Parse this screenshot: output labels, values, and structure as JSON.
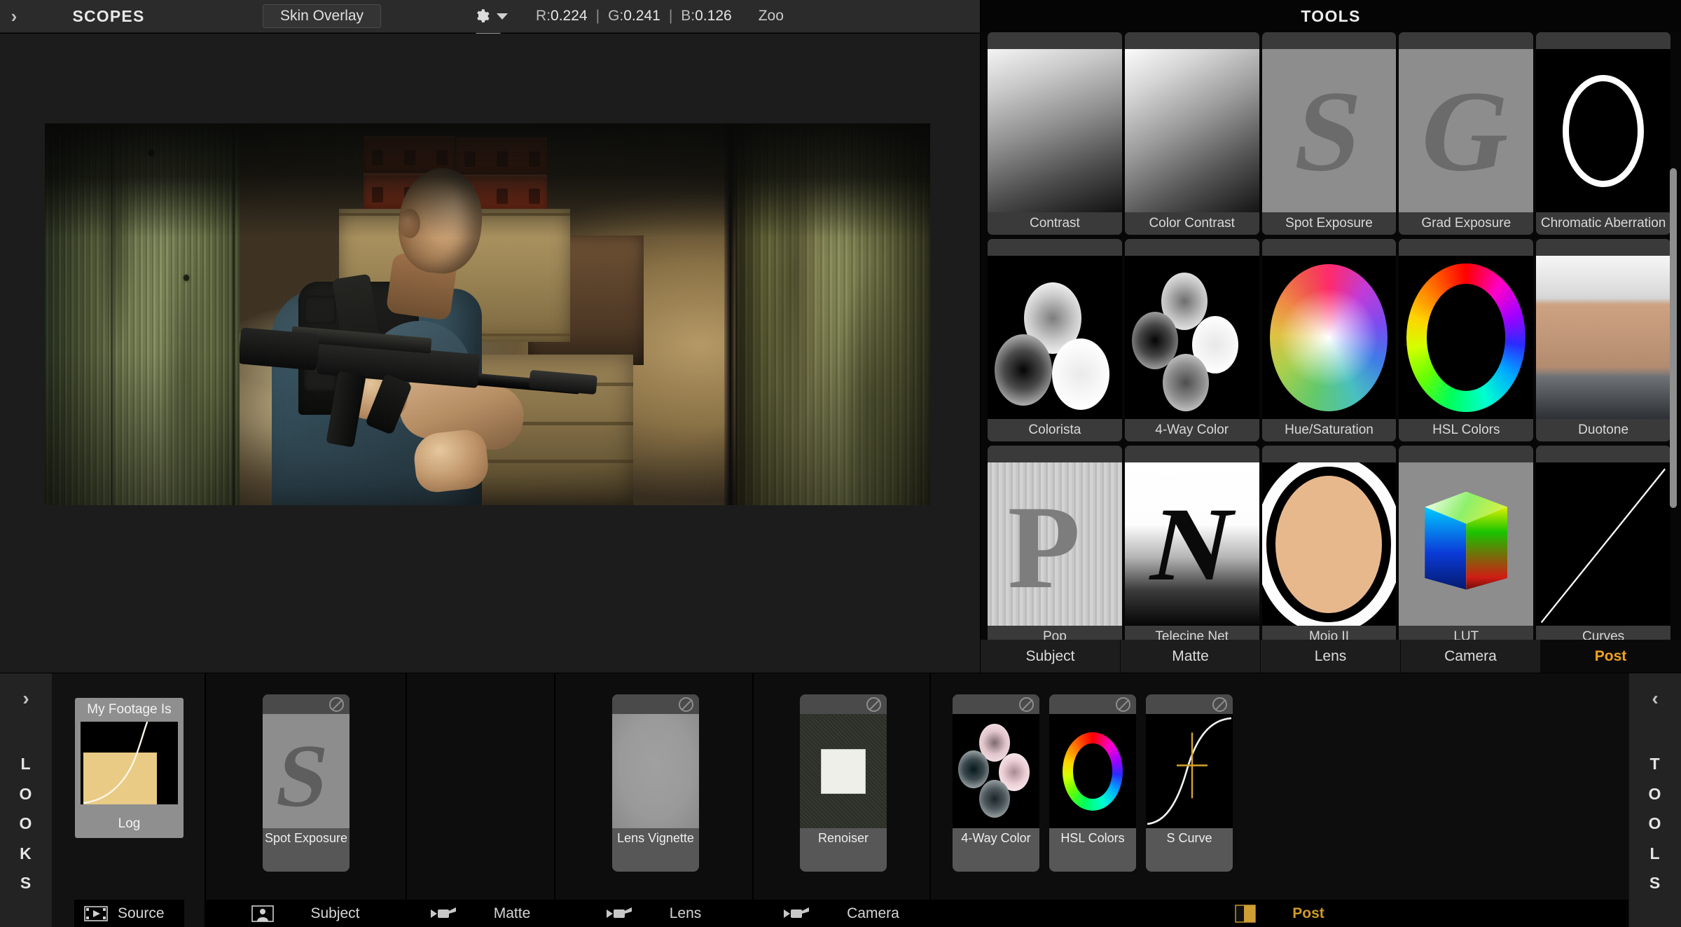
{
  "topbar": {
    "collapse_icon": "chevron-right-icon",
    "title": "SCOPES",
    "skin_overlay_label": "Skin Overlay",
    "gear_icon": "gear-icon",
    "gear_caret_icon": "chevron-down-icon",
    "readout": {
      "r_label": "R: ",
      "r_value": "0.224",
      "sep1": "|",
      "g_label": "G: ",
      "g_value": "0.241",
      "sep2": "|",
      "b_label": "B: ",
      "b_value": "0.126",
      "zoom_label": "Zoo"
    }
  },
  "viewer": {
    "name": "video-preview"
  },
  "tools_panel": {
    "title": "TOOLS",
    "accent_color": "#f0a31e",
    "cards": [
      {
        "label": "Contrast",
        "thumb": "grayscale-gradient-swatch"
      },
      {
        "label": "Color Contrast",
        "thumb": "grayscale-gradient-swatch"
      },
      {
        "label": "Spot Exposure",
        "thumb": "letter-S-glyph"
      },
      {
        "label": "Grad Exposure",
        "thumb": "letter-G-glyph"
      },
      {
        "label": "Chromatic Aberration",
        "thumb": "white-ring-outline"
      },
      {
        "label": "Colorista",
        "thumb": "three-color-blobs"
      },
      {
        "label": "4-Way Color",
        "thumb": "four-color-blobs"
      },
      {
        "label": "Hue/Saturation",
        "thumb": "hue-saturation-wheel"
      },
      {
        "label": "HSL Colors",
        "thumb": "hsl-color-ring"
      },
      {
        "label": "Duotone",
        "thumb": "duotone-gradient-swatch"
      },
      {
        "label": "Pop",
        "thumb": "letter-P-glyph"
      },
      {
        "label": "Telecine Net",
        "thumb": "letter-N-glyph"
      },
      {
        "label": "Mojo II",
        "thumb": "letter-O-glyph"
      },
      {
        "label": "LUT",
        "thumb": "rgb-color-cube"
      },
      {
        "label": "Curves",
        "thumb": "diagonal-curve-line"
      }
    ],
    "tabs": [
      {
        "label": "Subject",
        "active": false
      },
      {
        "label": "Matte",
        "active": false
      },
      {
        "label": "Lens",
        "active": false
      },
      {
        "label": "Camera",
        "active": false
      },
      {
        "label": "Post",
        "active": true
      }
    ],
    "scrollbar": "vertical-scrollbar"
  },
  "bottom_bar": {
    "left_rail": {
      "collapse_icon": "chevron-right-icon",
      "label": "LOOKS"
    },
    "right_rail": {
      "collapse_icon": "chevron-left-icon",
      "label": "TOOLS"
    },
    "looks": {
      "card_title": "My Footage Is",
      "card_value": "Log",
      "card_thumb": "log-curve-graph",
      "card_thumb_color": "#e9cb85",
      "footer_icon": "film-strip-icon",
      "footer_label": "Source"
    },
    "sections": [
      {
        "footer_label": "Subject",
        "footer_icon": "person-icon",
        "active": false,
        "effects": [
          {
            "label": "Spot Exposure",
            "thumb": "letter-S-glyph",
            "disable_icon": "no-entry-icon"
          }
        ]
      },
      {
        "footer_label": "Matte",
        "footer_icon": "camera-icon",
        "active": false,
        "effects": []
      },
      {
        "footer_label": "Lens",
        "footer_icon": "camera-icon",
        "active": false,
        "effects": [
          {
            "label": "Lens Vignette",
            "thumb": "vignette-swatch",
            "disable_icon": "no-entry-icon"
          }
        ]
      },
      {
        "footer_label": "Camera",
        "footer_icon": "camera-icon",
        "active": false,
        "effects": [
          {
            "label": "Renoiser",
            "thumb": "noise-patch-swatch",
            "disable_icon": "no-entry-icon"
          }
        ]
      },
      {
        "footer_label": "Post",
        "footer_icon": "post-wedge-icon",
        "active": true,
        "effects": [
          {
            "label": "4-Way Color",
            "thumb": "four-color-blobs",
            "disable_icon": "no-entry-icon"
          },
          {
            "label": "HSL Colors",
            "thumb": "hsl-color-ring",
            "disable_icon": "no-entry-icon"
          },
          {
            "label": "S Curve",
            "thumb": "s-curve-graph",
            "disable_icon": "no-entry-icon"
          }
        ]
      }
    ]
  }
}
